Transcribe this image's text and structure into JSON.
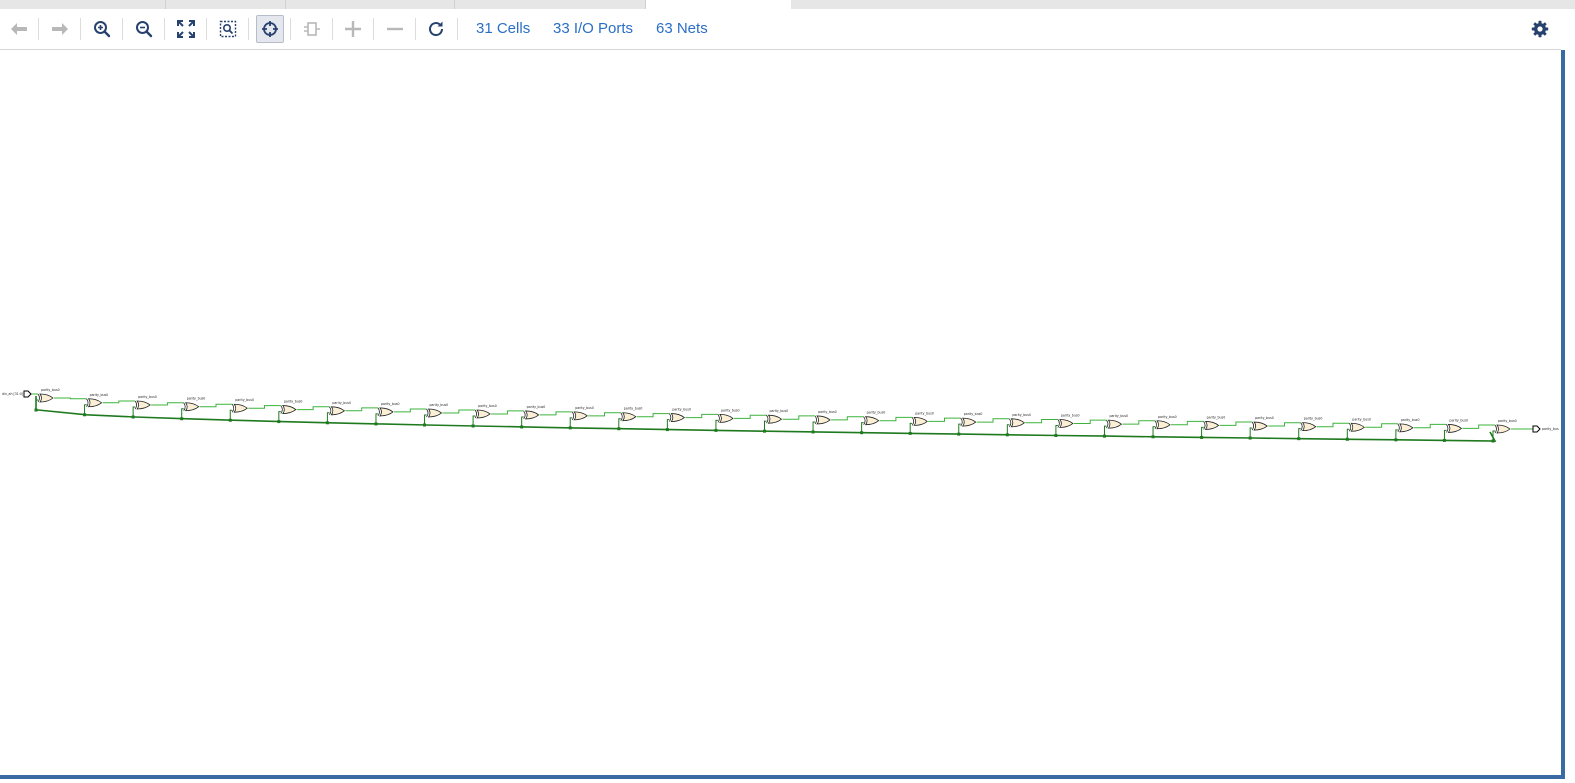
{
  "toolbar": {
    "buttons": [
      {
        "icon": "back-arrow-icon",
        "glyph": "←",
        "enabled": false
      },
      {
        "icon": "forward-arrow-icon",
        "glyph": "→",
        "enabled": false
      },
      {
        "icon": "zoom-in-icon",
        "enabled": true
      },
      {
        "icon": "zoom-out-icon",
        "enabled": true
      },
      {
        "icon": "zoom-fit-icon",
        "enabled": true
      },
      {
        "icon": "zoom-area-icon",
        "enabled": true
      },
      {
        "icon": "autofit-selection-icon",
        "enabled": true,
        "pressed": true
      },
      {
        "icon": "expand-cell-icon",
        "enabled": false
      },
      {
        "icon": "plus-icon",
        "glyph": "+",
        "enabled": false
      },
      {
        "icon": "minus-icon",
        "glyph": "−",
        "enabled": false
      },
      {
        "icon": "refresh-icon",
        "glyph": "↻",
        "enabled": true
      }
    ],
    "counts": {
      "cells": "31 Cells",
      "io_ports": "33 I/O Ports",
      "nets": "63 Nets"
    },
    "settings_icon": "gear-icon"
  },
  "schematic": {
    "input_port_label": "din_ah [31:0]",
    "output_port_label": "parity_bus",
    "cell_label_prefix": "parity_bus0",
    "gate_count": 31,
    "colors": {
      "wire": "#3cb43c",
      "bus": "#1f7a1f",
      "gate_fill": "#fbefd6",
      "gate_stroke": "#222222",
      "accent_border": "#3a6aa4",
      "link": "#2a6fc6",
      "icon": "#27426e",
      "icon_disabled": "#b8b8b8"
    }
  }
}
